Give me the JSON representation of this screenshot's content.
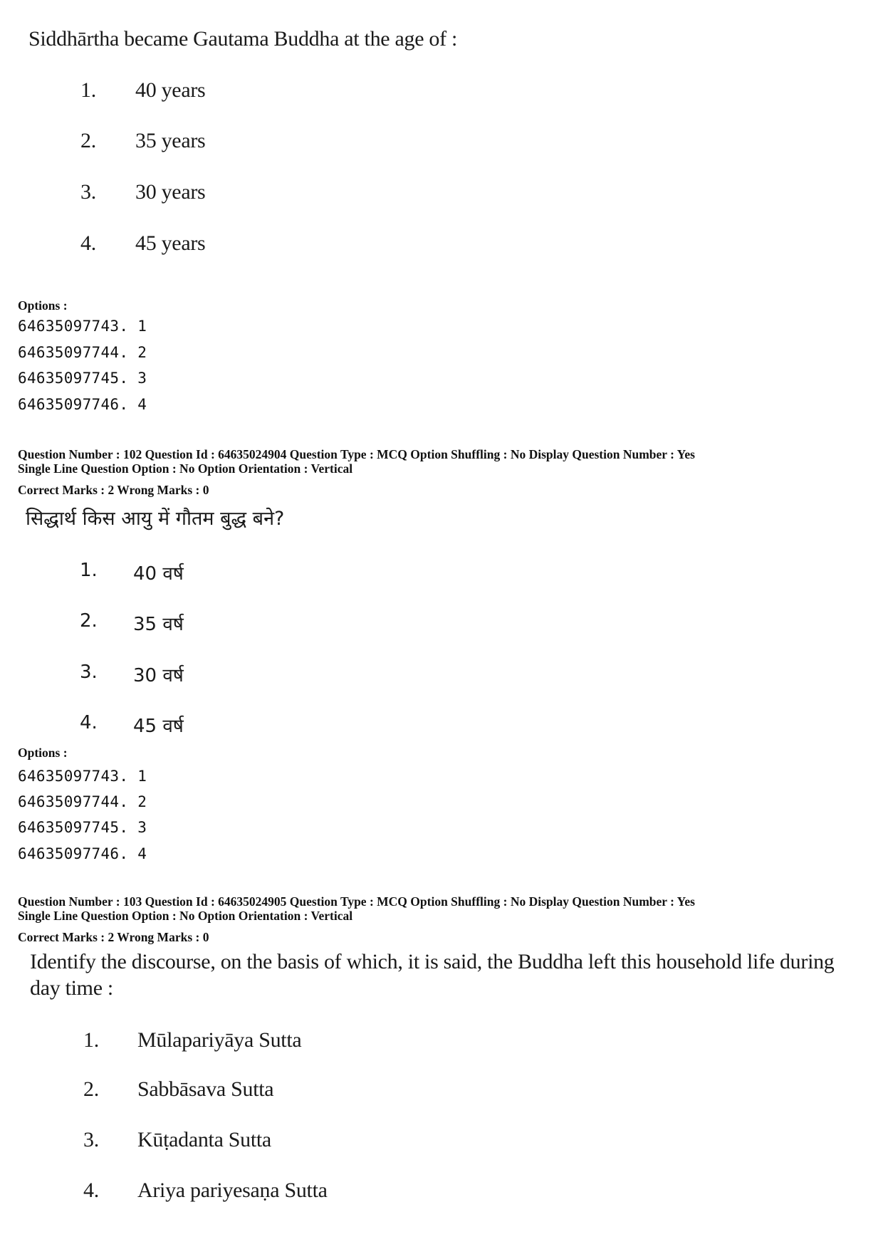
{
  "block1": {
    "question": "Siddhārtha became Gautama Buddha at the age of :",
    "choices": [
      {
        "num": "1.",
        "text": "40 years"
      },
      {
        "num": "2.",
        "text": "35 years"
      },
      {
        "num": "3.",
        "text": "30 years"
      },
      {
        "num": "4.",
        "text": "45 years"
      }
    ],
    "options_label": "Options :",
    "option_ids": [
      "64635097743. 1",
      "64635097744. 2",
      "64635097745. 3",
      "64635097746. 4"
    ]
  },
  "block2": {
    "meta_line1": "Question Number : 102  Question Id : 64635024904  Question Type : MCQ  Option Shuffling : No  Display Question Number : Yes",
    "meta_line2": "Single Line Question Option : No  Option Orientation : Vertical",
    "marks": "Correct Marks : 2  Wrong Marks : 0",
    "question": "सिद्धार्थ किस आयु में गौतम बुद्ध बने?",
    "choices": [
      {
        "num": "1.",
        "text": "40 वर्ष"
      },
      {
        "num": "2.",
        "text": "35 वर्ष"
      },
      {
        "num": "3.",
        "text": "30 वर्ष"
      },
      {
        "num": "4.",
        "text": "45 वर्ष"
      }
    ],
    "options_label": "Options :",
    "option_ids": [
      "64635097743. 1",
      "64635097744. 2",
      "64635097745. 3",
      "64635097746. 4"
    ]
  },
  "block3": {
    "meta_line1": "Question Number : 103  Question Id : 64635024905  Question Type : MCQ  Option Shuffling : No  Display Question Number : Yes",
    "meta_line2": "Single Line Question Option : No  Option Orientation : Vertical",
    "marks": "Correct Marks : 2  Wrong Marks : 0",
    "question": "Identify the discourse, on the basis of which, it is said, the Buddha left this household life during day time :",
    "choices": [
      {
        "num": "1.",
        "text": "Mūlapariyāya Sutta"
      },
      {
        "num": "2.",
        "text": "Sabbāsava Sutta"
      },
      {
        "num": "3.",
        "text": "Kūṭadanta Sutta"
      },
      {
        "num": "4.",
        "text": "Ariya pariyesaṇa Sutta"
      }
    ]
  }
}
